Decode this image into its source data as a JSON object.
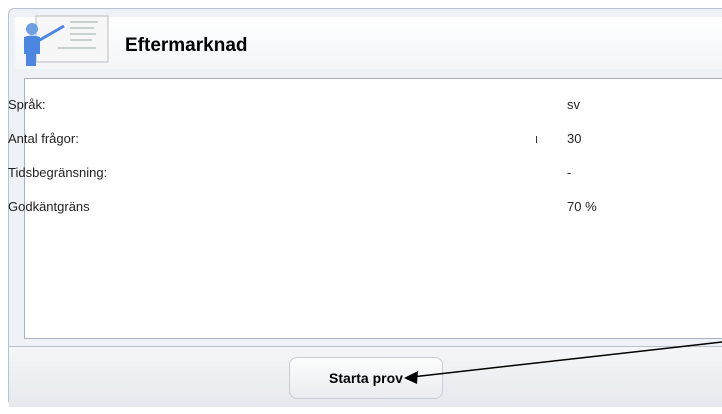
{
  "header": {
    "title": "Eftermarknad",
    "logo_icon": "presenter-board-icon"
  },
  "details": [
    {
      "label": "Språk:",
      "value": "sv"
    },
    {
      "label": "Antal frågor:",
      "value": "30"
    },
    {
      "label": "Tidsbegränsning:",
      "value": "-"
    },
    {
      "label": "Godkäntgräns",
      "value": "70 %"
    }
  ],
  "footer": {
    "start_button_label": "Starta prov"
  },
  "annotation": {
    "arrow_icon": "annotation-arrow-icon",
    "color": "#000000"
  }
}
